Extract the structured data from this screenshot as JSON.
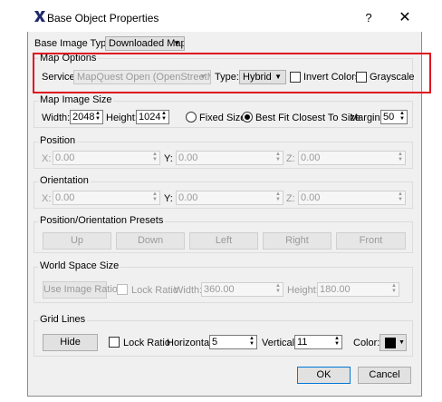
{
  "window": {
    "title": "Base Object Properties",
    "help_label": "?",
    "close_label": "✕"
  },
  "base_image_type": {
    "label": "Base Image Type:",
    "value": "Downloaded Map"
  },
  "map_options": {
    "title": "Map Options",
    "service_label": "Service:",
    "service_value": "MapQuest Open (OpenStreetMap)",
    "type_label": "Type:",
    "type_value": "Hybrid",
    "invert_colors_label": "Invert Colors",
    "grayscale_label": "Grayscale"
  },
  "map_image_size": {
    "title": "Map Image Size",
    "width_label": "Width:",
    "width_value": "2048",
    "height_label": "Height:",
    "height_value": "1024",
    "fixed_size_label": "Fixed Size",
    "best_fit_label": "Best Fit Closest To Size",
    "margin_label": "Margin:",
    "margin_value": "50"
  },
  "position": {
    "title": "Position",
    "x_label": "X:",
    "x_value": "0.00",
    "y_label": "Y:",
    "y_value": "0.00",
    "z_label": "Z:",
    "z_value": "0.00"
  },
  "orientation": {
    "title": "Orientation",
    "x_label": "X:",
    "x_value": "0.00",
    "y_label": "Y:",
    "y_value": "0.00",
    "z_label": "Z:",
    "z_value": "0.00"
  },
  "presets": {
    "title": "Position/Orientation Presets",
    "up": "Up",
    "down": "Down",
    "left": "Left",
    "right": "Right",
    "front": "Front"
  },
  "world_space": {
    "title": "World Space Size",
    "use_image_ratio": "Use Image Ratio",
    "lock_ratio_label": "Lock Ratio",
    "width_label": "Width:",
    "width_value": "360.00",
    "height_label": "Height:",
    "height_value": "180.00"
  },
  "grid_lines": {
    "title": "Grid Lines",
    "hide_label": "Hide",
    "lock_ratio_label": "Lock Ratio",
    "horizontal_label": "Horizontal:",
    "horizontal_value": "5",
    "vertical_label": "Vertical:",
    "vertical_value": "11",
    "color_label": "Color:",
    "color_value": "#000000"
  },
  "footer": {
    "ok": "OK",
    "cancel": "Cancel"
  },
  "colors": {
    "highlight": "#e0141e",
    "accent": "#0078d7"
  },
  "icons": {
    "app": "app-logo-x-icon",
    "combo_arrow": "chevron-down-icon",
    "spin_arrows": "spin-arrows-icon"
  }
}
